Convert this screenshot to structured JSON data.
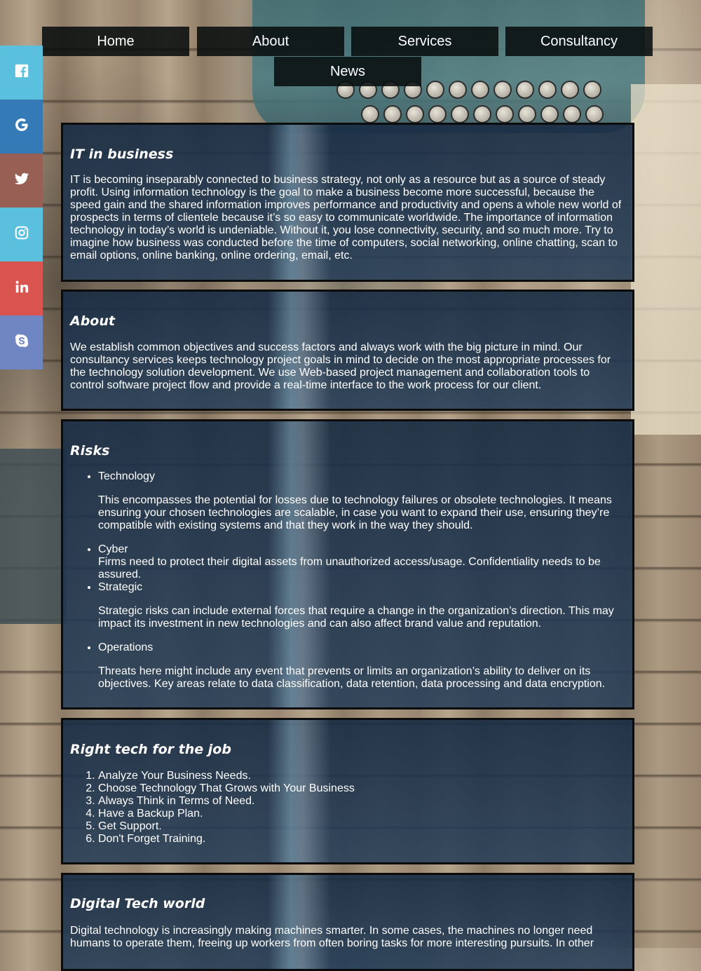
{
  "nav": {
    "items": [
      "Home",
      "About",
      "Services",
      "Consultancy",
      "News"
    ]
  },
  "social": {
    "items": [
      {
        "icon": "facebook-icon",
        "color": "#5bc0de"
      },
      {
        "icon": "google-icon",
        "color": "#337ab7"
      },
      {
        "icon": "twitter-icon",
        "color": "#985f54"
      },
      {
        "icon": "instagram-icon",
        "color": "#5bc0de"
      },
      {
        "icon": "linkedin-icon",
        "color": "#d9534f"
      },
      {
        "icon": "skype-icon",
        "color": "#6f86c2"
      }
    ]
  },
  "sections": {
    "it_business": {
      "title": "IT in business",
      "text": "IT is becoming inseparably connected to business strategy, not only as a resource but as a source of steady profit. Using information technology is the goal to make a business become more successful, because the speed gain and the shared information improves performance and productivity and opens a whole new world of prospects in terms of clientele because it’s so easy to communicate worldwide. The importance of information technology in today’s world is undeniable. Without it, you lose connectivity, security, and so much more. Try to imagine how business was conducted before the time of computers, social networking, online chatting, scan to email options, online banking, online ordering, email, etc."
    },
    "about": {
      "title": "About",
      "text": "We establish common objectives and success factors and always work with the big picture in mind. Our consultancy services keeps technology project goals in mind to decide on the most appropriate processes for the technology solution development. We use Web-based project management and collaboration tools to control software project flow and provide a real-time interface to the work process for our client."
    },
    "risks": {
      "title": "Risks",
      "items": [
        {
          "name": "Technology",
          "desc": "This encompasses the potential for losses due to technology failures or obsolete technologies. It means ensuring your chosen technologies are scalable, in case you want to expand their use, ensuring they’re compatible with existing systems and that they work in the way they should."
        },
        {
          "name": "Cyber",
          "desc": "Firms need to protect their digital assets from unauthorized access/usage. Confidentiality needs to be assured."
        },
        {
          "name": "Strategic",
          "desc": "Strategic risks can include external forces that require a change in the organization’s direction. This may impact its investment in new technologies and can also affect brand value and reputation."
        },
        {
          "name": "Operations",
          "desc": "Threats here might include any event that prevents or limits an organization’s ability to deliver on its objectives. Key areas relate to data classification, data retention, data processing and data encryption."
        }
      ]
    },
    "right_tech": {
      "title": "Right tech for the job",
      "items": [
        "Analyze Your Business Needs.",
        "Choose Technology That Grows with Your Business",
        "Always Think in Terms of Need.",
        "Have a Backup Plan.",
        "Get Support.",
        "Don't Forget Training."
      ]
    },
    "digital": {
      "title": "Digital Tech world",
      "text": "Digital technology is increasingly making machines smarter. In some cases, the machines no longer need humans to operate them, freeing up workers from often boring tasks for more interesting pursuits. In other"
    }
  }
}
